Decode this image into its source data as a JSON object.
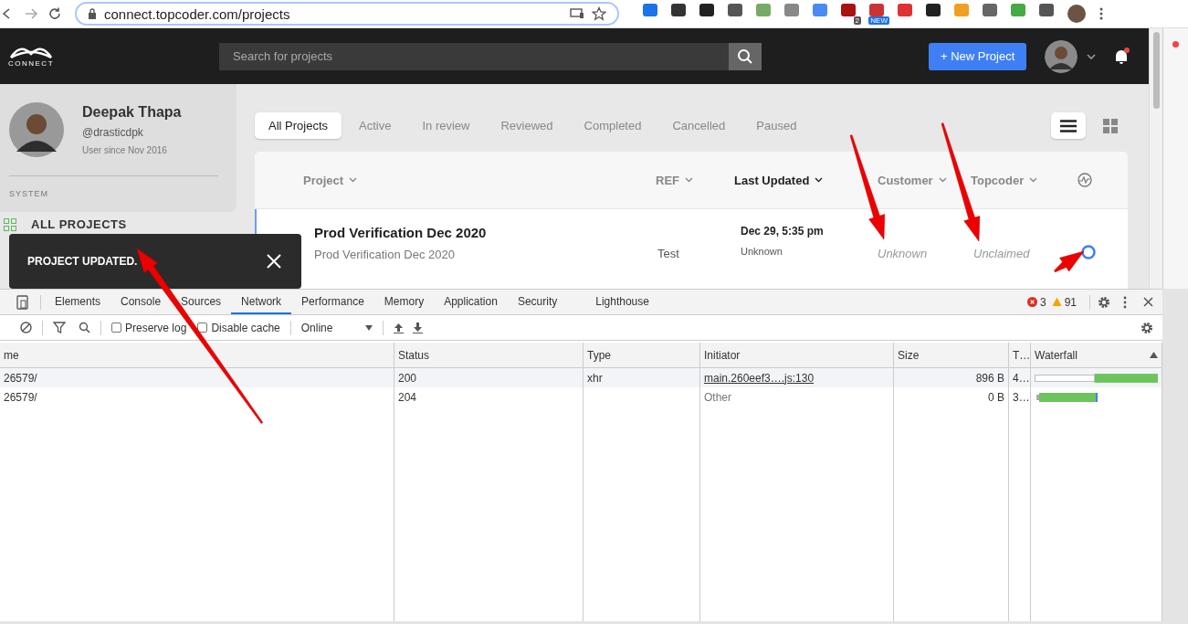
{
  "browser": {
    "url": "connect.topcoder.com/projects",
    "badges": [
      "2",
      "NEW"
    ]
  },
  "header": {
    "logo": "CONNECT",
    "search": {
      "placeholder": "Search for projects"
    },
    "new_project": "+ New Project"
  },
  "user": {
    "name": "Deepak Thapa",
    "handle": "@drasticdpk",
    "since": "User since Nov 2016"
  },
  "sidebar": {
    "section": "SYSTEM",
    "items": [
      {
        "label": "ALL PROJECTS"
      }
    ]
  },
  "tabs": [
    {
      "label": "All Projects",
      "selected": true
    },
    {
      "label": "Active",
      "selected": false
    },
    {
      "label": "In review",
      "selected": false
    },
    {
      "label": "Reviewed",
      "selected": false
    },
    {
      "label": "Completed",
      "selected": false
    },
    {
      "label": "Cancelled",
      "selected": false
    },
    {
      "label": "Paused",
      "selected": false
    }
  ],
  "view_toggle": [
    {
      "kind": "list",
      "selected": true
    },
    {
      "kind": "grid",
      "selected": false
    }
  ],
  "table": {
    "columns": [
      {
        "label": "Project",
        "sorted": false
      },
      {
        "label": "REF",
        "sorted": false
      },
      {
        "label": "Last Updated",
        "sorted": true
      },
      {
        "label": "Customer",
        "sorted": false
      },
      {
        "label": "Topcoder",
        "sorted": false
      }
    ],
    "rows": [
      {
        "name": "Prod Verification Dec 2020",
        "description": "Prod Verification Dec 2020",
        "ref": "Test",
        "updated": "Dec 29, 5:35 pm",
        "updated_by": "Unknown",
        "customer": "Unknown",
        "topcoder": "Unclaimed"
      }
    ]
  },
  "toast": {
    "message": "PROJECT UPDATED."
  },
  "devtools": {
    "tabs": [
      {
        "label": "Elements",
        "selected": false
      },
      {
        "label": "Console",
        "selected": false
      },
      {
        "label": "Sources",
        "selected": false
      },
      {
        "label": "Network",
        "selected": true
      },
      {
        "label": "Performance",
        "selected": false
      },
      {
        "label": "Memory",
        "selected": false
      },
      {
        "label": "Application",
        "selected": false
      },
      {
        "label": "Security",
        "selected": false
      },
      {
        "label": "Lighthouse",
        "selected": false
      }
    ],
    "errors": "3",
    "warnings": "91",
    "options": [
      {
        "label": "Preserve log",
        "checked": false
      },
      {
        "label": "Disable cache",
        "checked": false
      }
    ],
    "throttle": "Online",
    "columns": [
      "me",
      "Status",
      "Type",
      "Initiator",
      "Size",
      "T…",
      "Waterfall"
    ],
    "rows": [
      {
        "name": "26579/",
        "status": "200",
        "type": "xhr",
        "initiator": "main.260eef3….js:130",
        "initiator_link": true,
        "size": "896 B",
        "time": "4…"
      },
      {
        "name": "26579/",
        "status": "204",
        "type": "",
        "initiator": "Other",
        "initiator_link": false,
        "size": "0 B",
        "time": "3…"
      }
    ]
  }
}
